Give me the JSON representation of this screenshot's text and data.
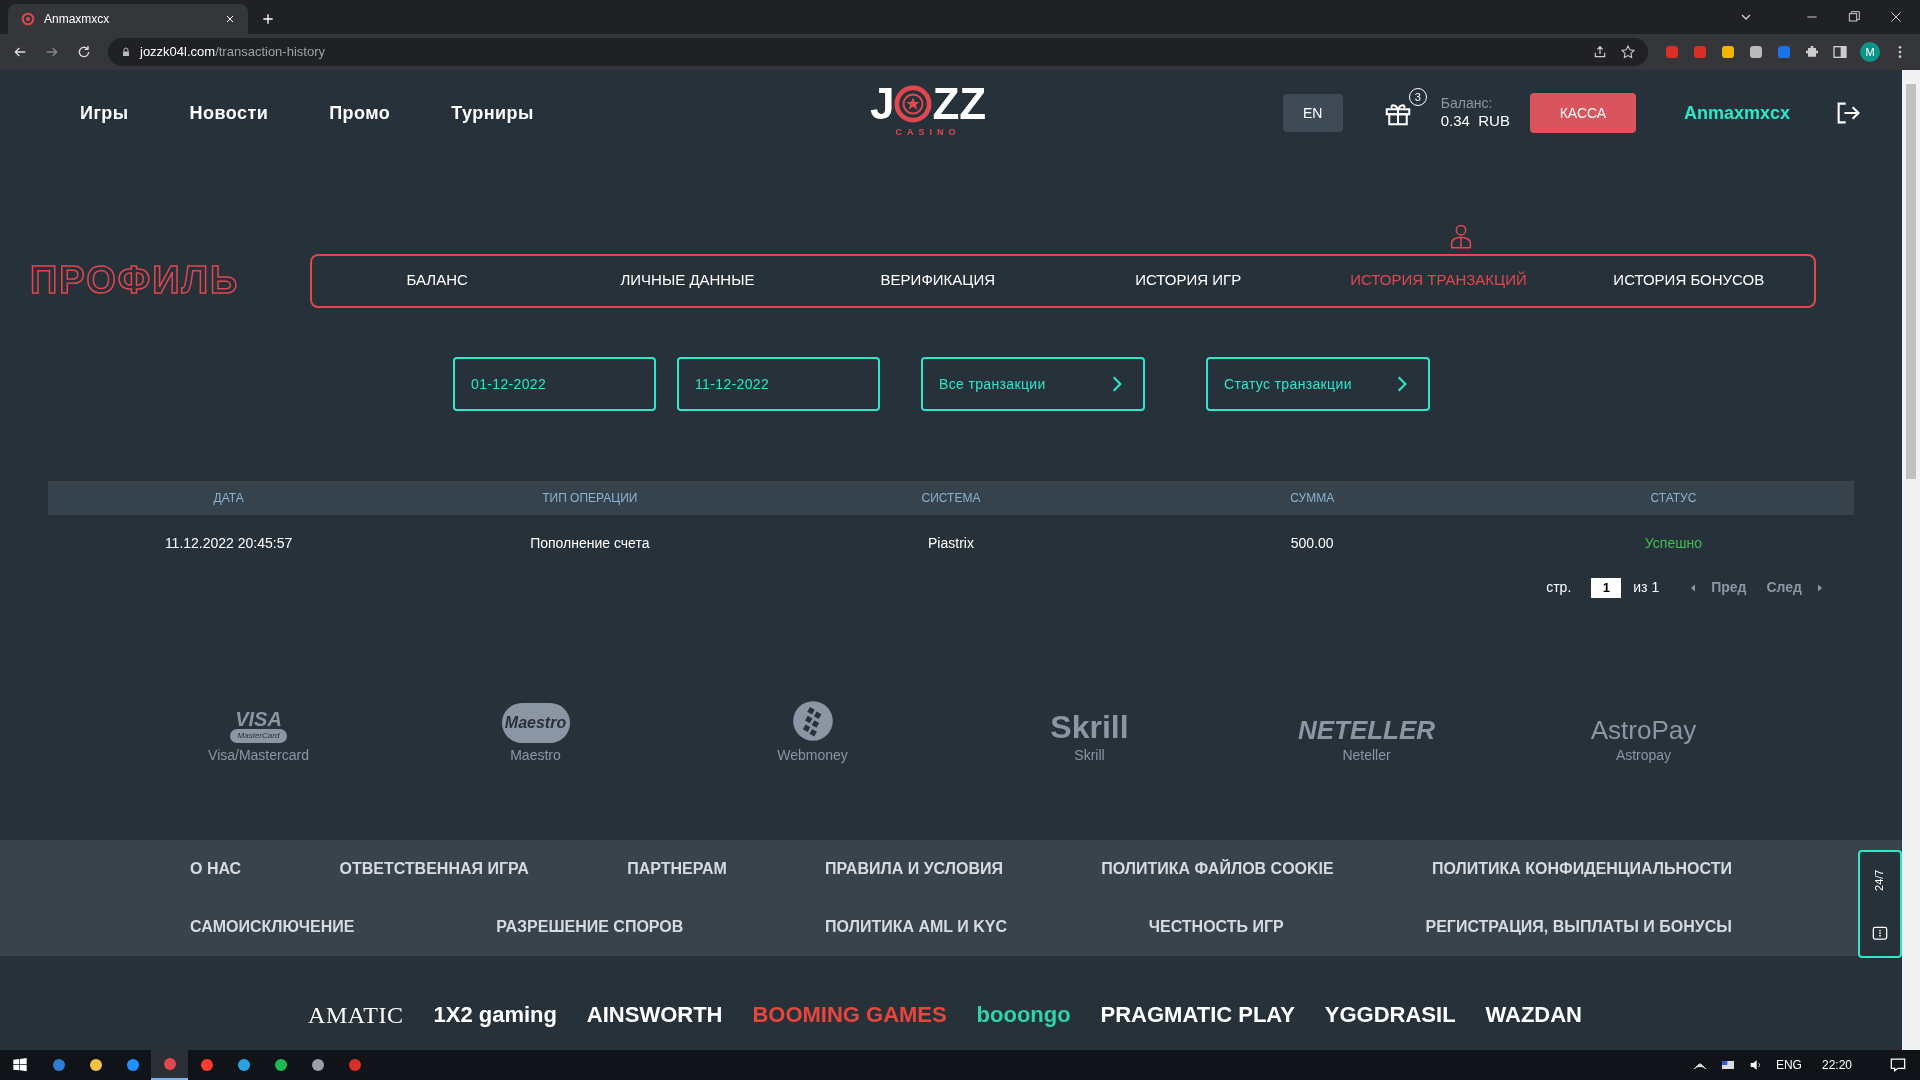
{
  "browser": {
    "tab_title": "Anmaxmxcx",
    "url_host": "jozzk04l.com",
    "url_path": "/transaction-history",
    "profile_initial": "M"
  },
  "header": {
    "nav": [
      "Игры",
      "Новости",
      "Промо",
      "Турниры"
    ],
    "logo": {
      "left": "J",
      "right": "ZZ",
      "sub": "CASINO"
    },
    "language": "EN",
    "gift_count": "3",
    "balance_label": "Баланс:",
    "balance_amount": "0.34",
    "balance_currency": "RUB",
    "cashier": "КАССА",
    "username": "Anmaxmxcx"
  },
  "profile": {
    "title": "ПРОФИЛЬ",
    "tabs": [
      {
        "label": "БАЛАНС",
        "selected": false
      },
      {
        "label": "ЛИЧНЫЕ ДАННЫЕ",
        "selected": false
      },
      {
        "label": "ВЕРИФИКАЦИЯ",
        "selected": false
      },
      {
        "label": "ИСТОРИЯ ИГР",
        "selected": false
      },
      {
        "label": "ИСТОРИЯ ТРАНЗАКЦИЙ",
        "selected": true
      },
      {
        "label": "ИСТОРИЯ БОНУСОВ",
        "selected": false
      }
    ]
  },
  "filters": {
    "date_from": "01-12-2022",
    "date_to": "11-12-2022",
    "type_select": "Все транзакции",
    "status_select": "Статус транзакции"
  },
  "table": {
    "columns": [
      "ДАТА",
      "ТИП ОПЕРАЦИИ",
      "СИСТЕМА",
      "СУММА",
      "СТАТУС"
    ],
    "rows": [
      {
        "cells": [
          "11.12.2022 20:45:57",
          "Пополнение счета",
          "Piastrix",
          "500.00",
          "Успешно"
        ],
        "color": "#3fbf4f"
      }
    ]
  },
  "pagination": {
    "page_label": "стр.",
    "page": "1",
    "of": "из 1",
    "prev": "Пред",
    "next": "След"
  },
  "payment_methods": [
    {
      "logo": "VISA",
      "logo_sub": "MasterCard",
      "label": "Visa/Mastercard"
    },
    {
      "logo": "Maestro",
      "label": "Maestro"
    },
    {
      "label": "Webmoney"
    },
    {
      "logo": "Skrill",
      "label": "Skrill"
    },
    {
      "logo": "NETELLER",
      "label": "Neteller"
    },
    {
      "logo": "AstroPay",
      "label": "Astropay"
    }
  ],
  "footer_links": [
    [
      "О НАС",
      "ОТВЕТСТВЕННАЯ ИГРА",
      "ПАРТНЕРАМ",
      "ПРАВИЛА И УСЛОВИЯ",
      "ПОЛИТИКА ФАЙЛОВ COOKIE",
      "ПОЛИТИКА КОНФИДЕНЦИАЛЬНОСТИ"
    ],
    [
      "САМОИСКЛЮЧЕНИЕ",
      "РАЗРЕШЕНИЕ СПОРОВ",
      "ПОЛИТИКА AML И KYC",
      "ЧЕСТНОСТЬ ИГР",
      "РЕГИСТРАЦИЯ, ВЫПЛАТЫ И БОНУСЫ"
    ]
  ],
  "support_widget": {
    "label": "24/7"
  },
  "providers": [
    {
      "name": "AMATIC",
      "color": "#ffffff"
    },
    {
      "name": "1X2 gaming",
      "color": "#ffffff"
    },
    {
      "name": "AINSWORTH",
      "color": "#ffffff"
    },
    {
      "name": "BOOMING GAMES",
      "color": "#e8463c"
    },
    {
      "name": "booongo",
      "color": "#2fd4a8"
    },
    {
      "name": "PRAGMATIC PLAY",
      "color": "#ffffff"
    },
    {
      "name": "YGGDRASIL",
      "color": "#ffffff"
    },
    {
      "name": "WAZDAN",
      "color": "#ffffff"
    }
  ],
  "taskbar": {
    "language": "ENG",
    "time": "22:20"
  }
}
